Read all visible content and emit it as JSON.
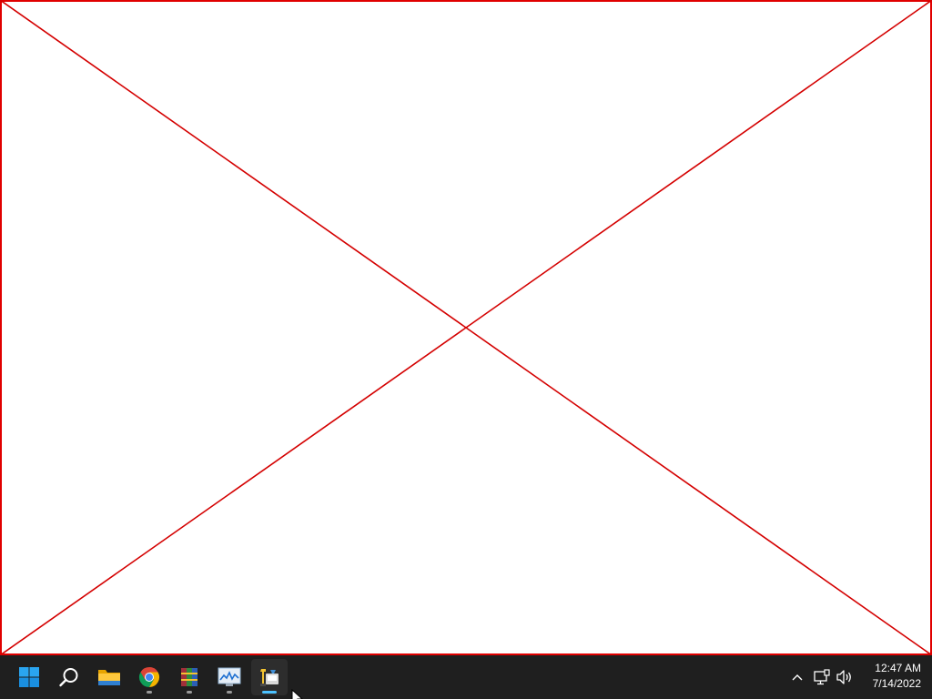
{
  "taskbar": {
    "clock": {
      "time": "12:47 AM",
      "date": "7/14/2022"
    },
    "apps": [
      {
        "icon": "windows-start-icon"
      },
      {
        "icon": "search-icon"
      },
      {
        "icon": "file-explorer-icon"
      },
      {
        "icon": "chrome-icon"
      },
      {
        "icon": "winrar-icon"
      },
      {
        "icon": "performance-monitor-icon"
      },
      {
        "icon": "installer-app-icon"
      }
    ],
    "tray": [
      {
        "icon": "chevron-up-icon"
      },
      {
        "icon": "network-icon"
      },
      {
        "icon": "volume-icon"
      }
    ]
  },
  "colors": {
    "taskbar_bg": "#1f1f1f",
    "placeholder_cross": "#e00000",
    "active_indicator": "#4cc2ff"
  }
}
